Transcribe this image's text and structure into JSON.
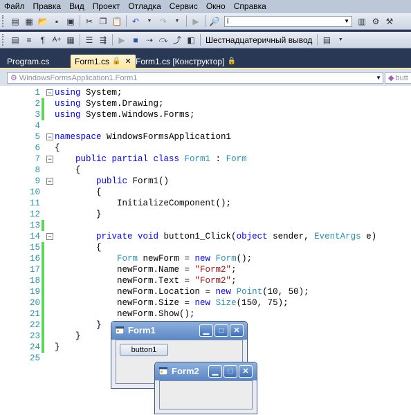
{
  "menu": [
    "Файл",
    "Правка",
    "Вид",
    "Проект",
    "Отладка",
    "Сервис",
    "Окно",
    "Справка"
  ],
  "toolbar1": {
    "find_value": "i"
  },
  "toolbar2": {
    "output_label": "Шестнадцатеричный вывод"
  },
  "tabs": [
    {
      "label": "Program.cs",
      "active": false
    },
    {
      "label": "Form1.cs",
      "active": true
    },
    {
      "label": "Form1.cs [Конструктор]",
      "active": false
    }
  ],
  "navigation": {
    "class_combo": "WindowsFormsApplication1.Form1",
    "member_combo": "butt"
  },
  "code_lines": [
    {
      "n": "1",
      "fold": "−",
      "changed": false
    },
    {
      "n": "2",
      "changed": true
    },
    {
      "n": "3",
      "changed": true
    },
    {
      "n": "4",
      "changed": false
    },
    {
      "n": "5",
      "fold": "−",
      "changed": false
    },
    {
      "n": "6",
      "changed": false
    },
    {
      "n": "7",
      "fold": "−",
      "changed": false
    },
    {
      "n": "8",
      "changed": false
    },
    {
      "n": "9",
      "fold": "−",
      "changed": false
    },
    {
      "n": "10",
      "changed": false
    },
    {
      "n": "11",
      "changed": false
    },
    {
      "n": "12",
      "changed": false
    },
    {
      "n": "13",
      "changed": true
    },
    {
      "n": "14",
      "fold": "−",
      "changed": false
    },
    {
      "n": "15",
      "changed": true
    },
    {
      "n": "16",
      "changed": true
    },
    {
      "n": "17",
      "changed": true
    },
    {
      "n": "18",
      "changed": true
    },
    {
      "n": "19",
      "changed": true
    },
    {
      "n": "20",
      "changed": true
    },
    {
      "n": "21",
      "changed": true
    },
    {
      "n": "22",
      "changed": true
    },
    {
      "n": "23",
      "changed": true
    },
    {
      "n": "24",
      "changed": true
    },
    {
      "n": "25",
      "changed": false
    }
  ],
  "code": {
    "l1a": "using",
    "l1b": " System;",
    "l2a": "using",
    "l2b": " System.Drawing;",
    "l3a": "using",
    "l3b": " System.Windows.Forms;",
    "l5a": "namespace",
    "l5b": " WindowsFormsApplication1",
    "l6": "{",
    "l7a": "    public partial class ",
    "l7b": "Form1",
    "l7c": " : ",
    "l7d": "Form",
    "l8": "    {",
    "l9a": "        public",
    "l9b": " Form1()",
    "l10": "        {",
    "l11": "            InitializeComponent();",
    "l12": "        }",
    "l14a": "        private void",
    "l14b": " button1_Click(",
    "l14c": "object",
    "l14d": " sender, ",
    "l14e": "EventArgs",
    "l14f": " e)",
    "l15": "        {",
    "l16a": "            ",
    "l16b": "Form",
    "l16c": " newForm = ",
    "l16d": "new",
    "l16e": " ",
    "l16f": "Form",
    "l16g": "();",
    "l17a": "            newForm.Name = ",
    "l17b": "\"Form2\"",
    "l17c": ";",
    "l18a": "            newForm.Text = ",
    "l18b": "\"Form2\"",
    "l18c": ";",
    "l19a": "            newForm.Location = ",
    "l19b": "new",
    "l19c": " ",
    "l19d": "Point",
    "l19e": "(10, 50);",
    "l20a": "            newForm.Size = ",
    "l20b": "new",
    "l20c": " ",
    "l20d": "Size",
    "l20e": "(150, 75);",
    "l21": "            newForm.Show();",
    "l22": "        }",
    "l23": "    }",
    "l24": "}"
  },
  "form1": {
    "title": "Form1",
    "button_label": "button1"
  },
  "form2": {
    "title": "Form2"
  }
}
